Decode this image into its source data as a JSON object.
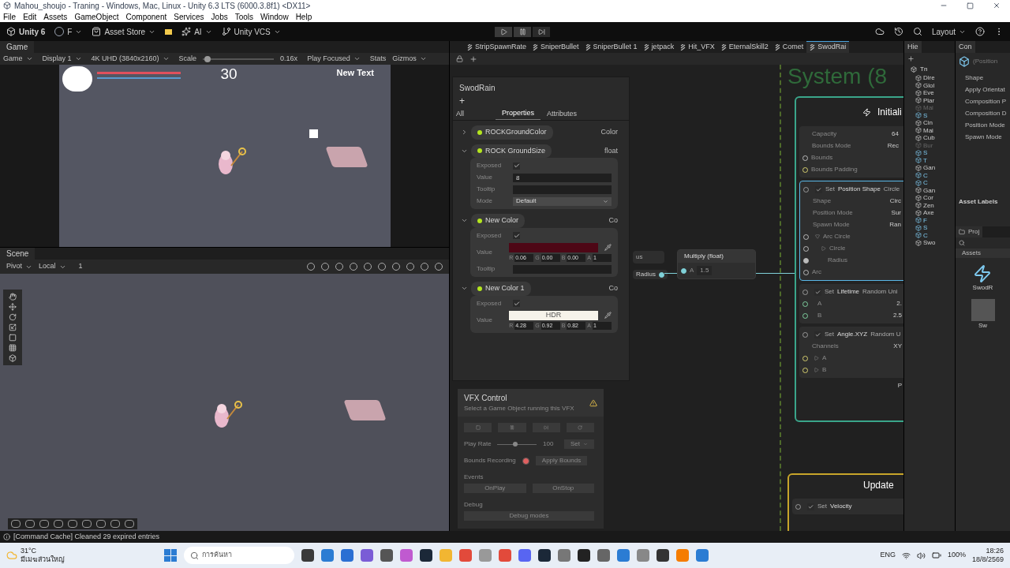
{
  "window": {
    "title": "Mahou_shoujo - Traning - Windows, Mac, Linux - Unity 6.3 LTS (6000.3.8f1) <DX11>"
  },
  "menu": [
    "File",
    "Edit",
    "Assets",
    "GameObject",
    "Component",
    "Services",
    "Jobs",
    "Tools",
    "Window",
    "Help"
  ],
  "toolbar": {
    "account": "Unity 6",
    "user": "F",
    "asset_store": "Asset Store",
    "ai": "AI",
    "vcs": "Unity VCS",
    "layout": "Layout"
  },
  "game": {
    "tab": "Game",
    "options": [
      "Game",
      "Display 1",
      "4K UHD (3840x2160)"
    ],
    "scale_label": "Scale",
    "scale_slider": {
      "level": 0.02
    },
    "scale": "0.16x",
    "play_mode": "Play Focused",
    "stats": "Stats",
    "gizmos": "Gizmos",
    "score": "30",
    "hud_text": "New Text"
  },
  "scene": {
    "tab": "Scene",
    "pivot": "Pivot",
    "local": "Local",
    "grid": "1"
  },
  "graph": {
    "tabs": [
      {
        "label": "StripSpawnRate",
        "selected": false
      },
      {
        "label": "SniperBullet",
        "selected": false
      },
      {
        "label": "SniperBullet 1",
        "selected": false
      },
      {
        "label": "jetpack",
        "selected": false
      },
      {
        "label": "Hit_VFX",
        "selected": false
      },
      {
        "label": "EternalSkill2",
        "selected": false
      },
      {
        "label": "Comet",
        "selected": false
      },
      {
        "label": "SwodRai",
        "selected": true
      }
    ],
    "system_title": "System (8",
    "chip_cut": "us",
    "radius_chip": "Radius",
    "multiply": {
      "title": "Multiply (float)",
      "input": "A",
      "value": "1.5"
    },
    "initialize": {
      "title": "Initiali",
      "settings": [
        {
          "label": "Capacity",
          "value": "64"
        },
        {
          "label": "Bounds Mode",
          "value": "Rec"
        }
      ],
      "ports": [
        "Bounds",
        "Bounds Padding"
      ],
      "blocks": [
        {
          "set": "Set",
          "name": "Position Shape",
          "mode": "Circle",
          "enabled": true,
          "selected": true,
          "settings": [
            {
              "label": "Shape",
              "value": "Circ"
            },
            {
              "label": "Position Mode",
              "value": "Sur"
            },
            {
              "label": "Spawn Mode",
              "value": "Ran"
            }
          ],
          "ports": [
            {
              "label": "Arc Circle",
              "kind": "open"
            },
            {
              "label": "Circle",
              "kind": "closed"
            },
            {
              "label": "Radius",
              "kind": "field"
            },
            {
              "label": "Arc",
              "kind": "port"
            }
          ]
        },
        {
          "set": "Set",
          "name": "Lifetime",
          "mode": "Random Uni",
          "enabled": true,
          "selected": false,
          "ports": [
            {
              "label": "A",
              "kind": "value",
              "value": "2."
            },
            {
              "label": "B",
              "kind": "value",
              "value": "2.5"
            }
          ]
        },
        {
          "set": "Set",
          "name": "Angle.XYZ",
          "mode": "Random U",
          "enabled": true,
          "selected": false,
          "settings": [
            {
              "label": "Channels",
              "value": "XY"
            }
          ],
          "ports": [
            {
              "label": "A",
              "kind": "closed"
            },
            {
              "label": "B",
              "kind": "closed"
            }
          ]
        }
      ],
      "footer": "P"
    },
    "update": {
      "title": "Update",
      "blocks": [
        {
          "set": "Set",
          "name": "Velocity",
          "enabled": true
        }
      ]
    }
  },
  "blackboard": {
    "title": "SwodRain",
    "add": "+",
    "tabs": [
      {
        "label": "All",
        "selected": false
      },
      {
        "label": "Properties",
        "selected": true
      },
      {
        "label": "Attributes",
        "selected": false
      }
    ],
    "properties": [
      {
        "name": "ROCKGroundColor",
        "type": "Color",
        "expanded": false
      },
      {
        "name": "ROCK GroundSize",
        "type": "float",
        "expanded": true,
        "fields": [
          {
            "kind": "check",
            "label": "Exposed",
            "checked": true
          },
          {
            "kind": "text",
            "label": "Value",
            "value": "8"
          },
          {
            "kind": "text",
            "label": "Tooltip"
          },
          {
            "kind": "dropdown",
            "label": "Mode",
            "value": "Default"
          }
        ]
      },
      {
        "name": "New Color",
        "type": "Co",
        "expanded": true,
        "fields": [
          {
            "kind": "check",
            "label": "Exposed",
            "checked": true
          },
          {
            "kind": "color",
            "label": "Value",
            "color": "#4e0716",
            "channels": [
              {
                "label": "R",
                "value": "0.06"
              },
              {
                "label": "G",
                "value": "0.00"
              },
              {
                "label": "B",
                "value": "0.00"
              },
              {
                "label": "A",
                "value": "1"
              }
            ]
          },
          {
            "kind": "text",
            "label": "Tooltip"
          }
        ]
      },
      {
        "name": "New Color 1",
        "type": "Co",
        "expanded": true,
        "fields": [
          {
            "kind": "check",
            "label": "Exposed",
            "checked": true
          },
          {
            "kind": "color",
            "label": "Value",
            "color": "#f6f3ea",
            "badge": "HDR",
            "channels": [
              {
                "label": "R",
                "value": "4.28"
              },
              {
                "label": "G",
                "value": "0.92"
              },
              {
                "label": "B",
                "value": "0.82"
              },
              {
                "label": "A",
                "value": "1"
              }
            ]
          }
        ]
      }
    ]
  },
  "vfx_control": {
    "title": "VFX Control",
    "hint": "Select a Game Object running this VFX",
    "play_rate": {
      "label": "Play Rate",
      "level": 0.45,
      "value": "100",
      "set": "Set"
    },
    "bounds": {
      "label": "Bounds Recording",
      "apply": "Apply Bounds"
    },
    "events_label": "Events",
    "events": [
      "OnPlay",
      "OnStop"
    ],
    "debug_label": "Debug",
    "debug_button": "Debug modes"
  },
  "hierarchy": {
    "tab": "Hie",
    "root": "Tn",
    "items": [
      {
        "name": "Dire",
        "kind": "object"
      },
      {
        "name": "Glol",
        "kind": "object"
      },
      {
        "name": "Eve",
        "kind": "object"
      },
      {
        "name": "Plar",
        "kind": "object"
      },
      {
        "name": "Mai",
        "kind": "inactive"
      },
      {
        "name": "S",
        "kind": "prefab"
      },
      {
        "name": "Cin",
        "kind": "object"
      },
      {
        "name": "Mai",
        "kind": "object"
      },
      {
        "name": "Cub",
        "kind": "object"
      },
      {
        "name": "Bur",
        "kind": "inactive"
      },
      {
        "name": "S",
        "kind": "prefab"
      },
      {
        "name": "T",
        "kind": "prefab"
      },
      {
        "name": "Gan",
        "kind": "object"
      },
      {
        "name": "C",
        "kind": "prefab"
      },
      {
        "name": "C",
        "kind": "prefab"
      },
      {
        "name": "Gan",
        "kind": "object"
      },
      {
        "name": "Cor",
        "kind": "object"
      },
      {
        "name": "Zen",
        "kind": "object"
      },
      {
        "name": "Axe",
        "kind": "object"
      },
      {
        "name": "F",
        "kind": "prefab"
      },
      {
        "name": "S",
        "kind": "prefab"
      },
      {
        "name": "C",
        "kind": "prefab"
      },
      {
        "name": "Swo",
        "kind": "object"
      }
    ]
  },
  "inspector": {
    "tab": "Con",
    "object": "(Position",
    "fields": [
      "Shape",
      "Apply Orientat",
      "Composition P",
      "Composition D",
      "Position Mode",
      "Spawn Mode"
    ],
    "asset_labels": "Asset Labels"
  },
  "project": {
    "tab": "Proj",
    "breadcrumb": "Assets",
    "assets": [
      {
        "name": "SwodR",
        "kind": "vfx"
      },
      {
        "name": "Sw",
        "kind": "texture"
      }
    ]
  },
  "status_bar": {
    "message": "[Command Cache] Cleaned 29 expired entries"
  },
  "taskbar": {
    "temp": "31°C",
    "weather": "มีเมฆส่วนใหญ่",
    "search": "การค้นหา",
    "lang": "ENG",
    "battery": "100%",
    "time": "18:26",
    "date": "18/8/2569"
  }
}
